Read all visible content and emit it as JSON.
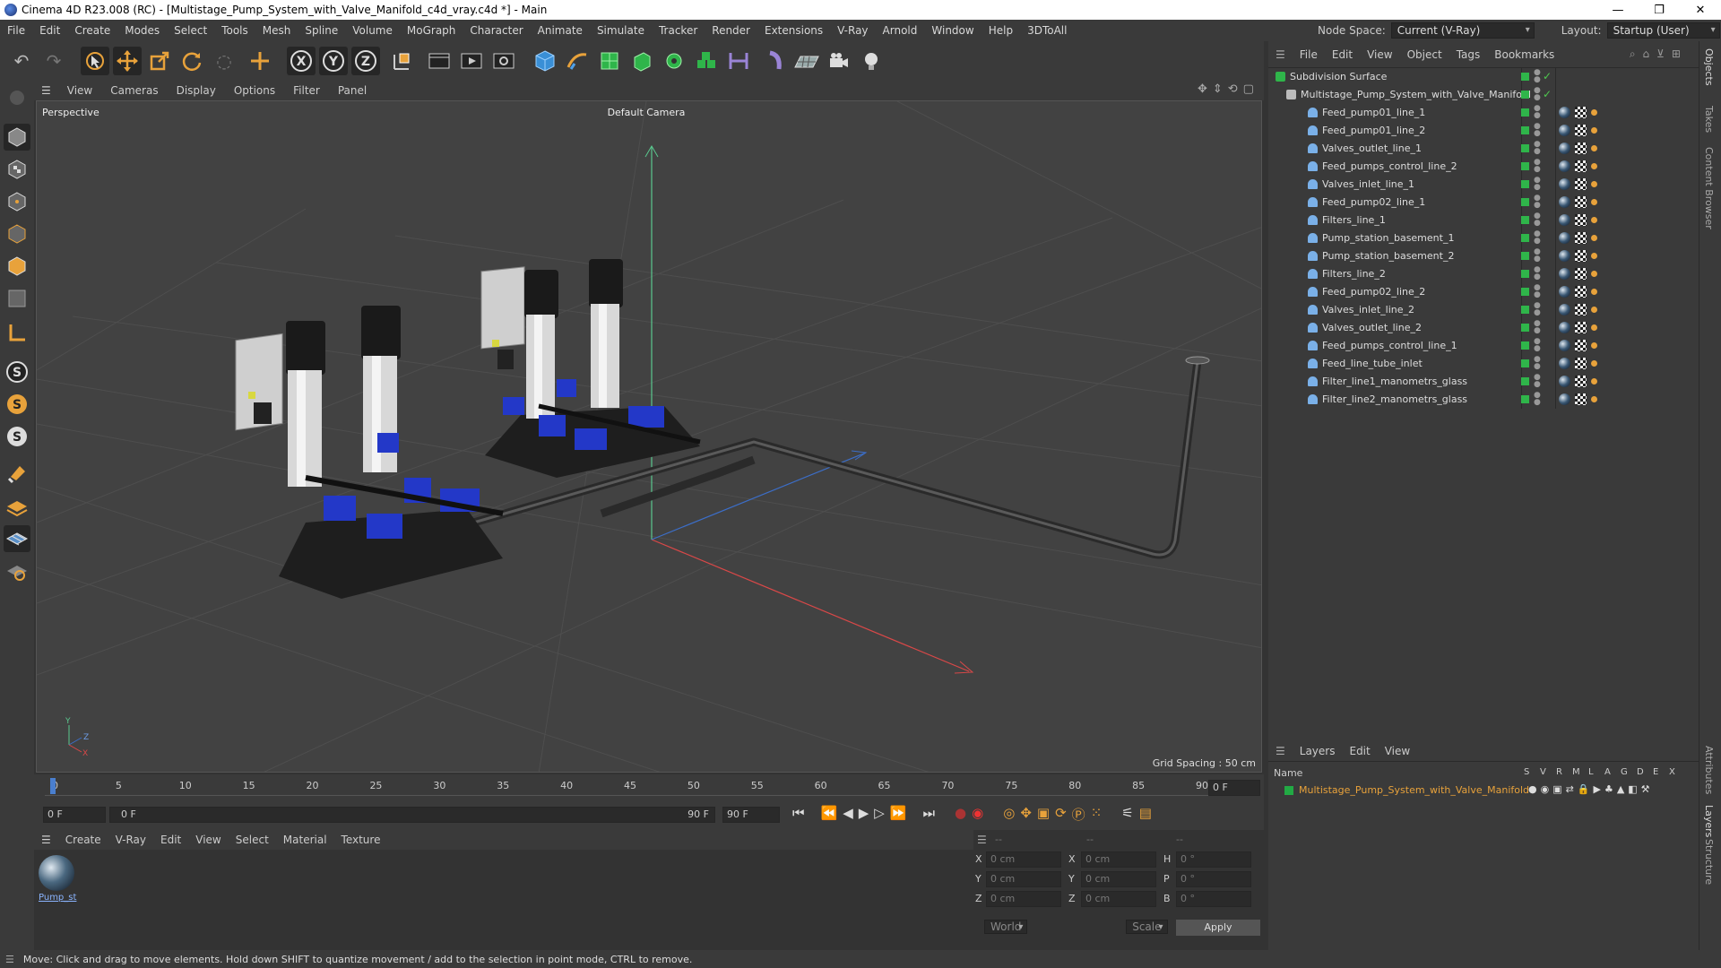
{
  "window": {
    "title": "Cinema 4D R23.008 (RC) - [Multistage_Pump_System_with_Valve_Manifold_c4d_vray.c4d *] - Main",
    "minimize": "—",
    "maximize": "❐",
    "close": "✕"
  },
  "menu": {
    "items": [
      "File",
      "Edit",
      "Create",
      "Modes",
      "Select",
      "Tools",
      "Mesh",
      "Spline",
      "Volume",
      "MoGraph",
      "Character",
      "Animate",
      "Simulate",
      "Tracker",
      "Render",
      "Extensions",
      "V-Ray",
      "Arnold",
      "Window",
      "Help",
      "3DToAll"
    ],
    "node_space_label": "Node Space:",
    "node_space_value": "Current (V-Ray)",
    "layout_label": "Layout:",
    "layout_value": "Startup (User)"
  },
  "toolbar": {
    "icons": [
      "undo-icon",
      "redo-icon",
      "select-icon",
      "move-icon",
      "scale-icon",
      "rotate-icon",
      "live-select-icon",
      "create-icon",
      "x-axis-icon",
      "y-axis-icon",
      "z-axis-icon",
      "world-coord-icon",
      "render-view-icon",
      "render-picture-viewer-icon",
      "render-settings-icon",
      "cube-icon",
      "pen-icon",
      "subdivision-icon",
      "extrude-icon",
      "array-icon",
      "mograph-cloner-icon",
      "ruler-icon",
      "deformer-icon",
      "floor-icon",
      "camera-icon",
      "light-icon"
    ],
    "axis_x": "X",
    "axis_y": "Y",
    "axis_z": "Z"
  },
  "left_tools": {
    "icons": [
      "viewport-solo-icon",
      "model-mode-icon",
      "texture-mode-icon",
      "points-mode-icon",
      "edges-mode-icon",
      "polygons-mode-icon",
      "uv-mode-icon",
      "workplane-icon",
      "snap-s-icon",
      "snap-s-orange-icon",
      "snap-s-white-icon",
      "magnet-icon",
      "grid-layer-icon",
      "grid-dots-icon",
      "grid-circle-icon"
    ],
    "snap_letter": "S"
  },
  "viewport": {
    "menu": [
      "View",
      "Cameras",
      "Display",
      "Options",
      "Filter",
      "Panel"
    ],
    "label": "Perspective",
    "camera": "Default Camera",
    "grid_spacing": "Grid Spacing : 50 cm",
    "axis_y": "Y",
    "axis_z": "Z",
    "axis_x": "X"
  },
  "timeline": {
    "ticks": [
      "0",
      "5",
      "10",
      "15",
      "20",
      "25",
      "30",
      "35",
      "40",
      "45",
      "50",
      "55",
      "60",
      "65",
      "70",
      "75",
      "80",
      "85",
      "90"
    ],
    "end_frame_field": "0 F",
    "current_frame": "0 F",
    "range_start": "0 F",
    "range_end": "90 F",
    "max_frame": "90 F"
  },
  "materials": {
    "menu": [
      "Create",
      "V-Ray",
      "Edit",
      "View",
      "Select",
      "Material",
      "Texture"
    ],
    "items": [
      {
        "name": "Pump_st"
      }
    ]
  },
  "coords": {
    "header": [
      "--",
      "--",
      "--"
    ],
    "rows": [
      {
        "a": "X",
        "av": "0 cm",
        "b": "X",
        "bv": "0 cm",
        "c": "H",
        "cv": "0 °"
      },
      {
        "a": "Y",
        "av": "0 cm",
        "b": "Y",
        "bv": "0 cm",
        "c": "P",
        "cv": "0 °"
      },
      {
        "a": "Z",
        "av": "0 cm",
        "b": "Z",
        "bv": "0 cm",
        "c": "B",
        "cv": "0 °"
      }
    ],
    "world": "World",
    "scale": "Scale",
    "apply": "Apply"
  },
  "status": "Move: Click and drag to move elements. Hold down SHIFT to quantize movement / add to the selection in point mode, CTRL to remove.",
  "objects": {
    "menu": [
      "File",
      "Edit",
      "View",
      "Object",
      "Tags",
      "Bookmarks"
    ],
    "root": "Subdivision Surface",
    "group": "Multistage_Pump_System_with_Valve_Manifold",
    "items": [
      "Feed_pump01_line_1",
      "Feed_pump01_line_2",
      "Valves_outlet_line_1",
      "Feed_pumps_control_line_2",
      "Valves_inlet_line_1",
      "Feed_pump02_line_1",
      "Filters_line_1",
      "Pump_station_basement_1",
      "Pump_station_basement_2",
      "Filters_line_2",
      "Feed_pump02_line_2",
      "Valves_inlet_line_2",
      "Valves_outlet_line_2",
      "Feed_pumps_control_line_1",
      "Feed_line_tube_inlet",
      "Filter_line1_manometrs_glass",
      "Filter_line2_manometrs_glass"
    ]
  },
  "layers": {
    "menu": [
      "Layers",
      "Edit",
      "View"
    ],
    "name_header": "Name",
    "cols": [
      "S",
      "V",
      "R",
      "M",
      "L",
      "A",
      "G",
      "D",
      "E",
      "X"
    ],
    "item": "Multistage_Pump_System_with_Valve_Manifold",
    "item_color": "#22aa44"
  },
  "right_tabs": [
    "Objects",
    "Takes",
    "Content Browser",
    "Attributes",
    "Layers",
    "Structure"
  ]
}
